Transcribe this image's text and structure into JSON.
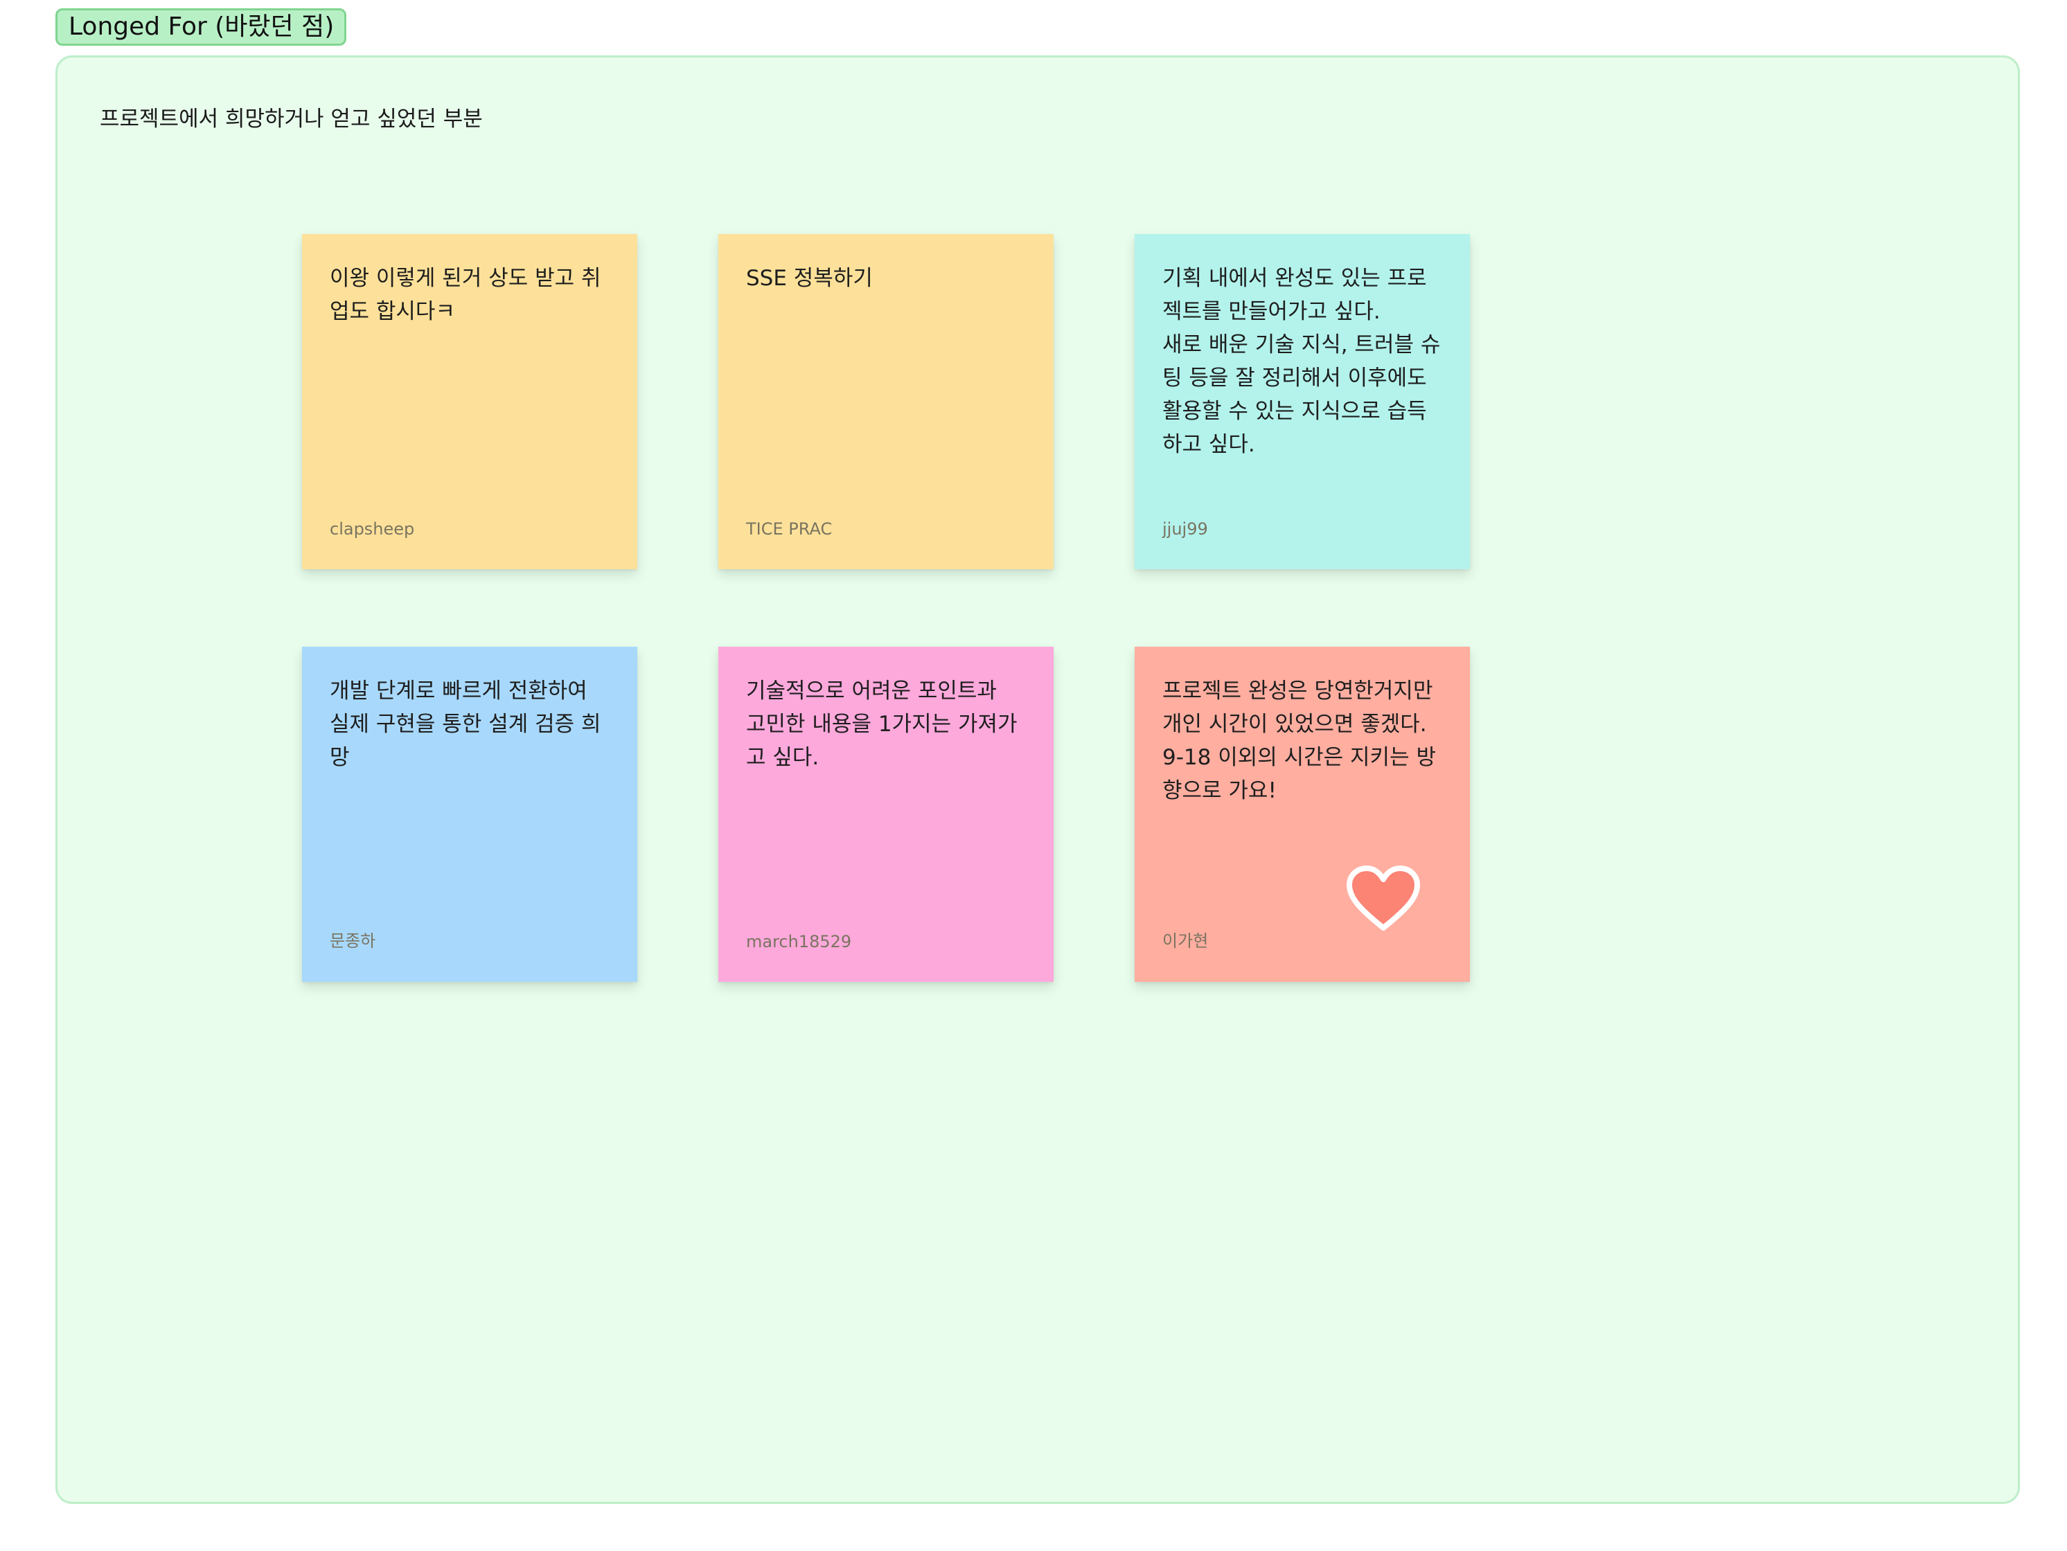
{
  "frame": {
    "tag_label": "Longed For (바랐던 점)",
    "description": "프로젝트에서 희망하거나 얻고 싶었던 부분"
  },
  "colors": {
    "section_bg": "#e8fdec",
    "tag_bg": "#b8f0c6",
    "yellow": "#fde19a",
    "cyan": "#b3f3ec",
    "blue": "#a8d9fd",
    "pink": "#fea9dc",
    "salmon": "#ffaea0",
    "heart_fill": "#fb8475"
  },
  "stickies": [
    {
      "text": "이왕 이렇게 된거 상도 받고 취\n업도 합시다ㅋ",
      "author": "clapsheep",
      "color": "yellow"
    },
    {
      "text": "SSE 정복하기",
      "author": "TICE PRAC",
      "color": "yellow"
    },
    {
      "text": "기획 내에서 완성도 있는 프로\n젝트를 만들어가고 싶다.\n새로 배운 기술 지식, 트러블 슈\n팅 등을 잘 정리해서 이후에도\n활용할 수 있는 지식으로 습득\n하고 싶다.",
      "author": "jjuj99",
      "color": "cyan"
    },
    {
      "text": "개발 단계로 빠르게 전환하여\n실제 구현을 통한 설계 검증 희\n망",
      "author": "문종하",
      "color": "blue"
    },
    {
      "text": "기술적으로 어려운 포인트과\n고민한 내용을 1가지는 가져가\n고 싶다.",
      "author": "march18529",
      "color": "pink"
    },
    {
      "text": "프로젝트 완성은 당연한거지만\n개인 시간이 있었으면 좋겠다.\n9-18 이외의 시간은 지키는 방\n향으로 가요!",
      "author": "이가현",
      "color": "salmon",
      "reaction": "heart-icon"
    }
  ]
}
